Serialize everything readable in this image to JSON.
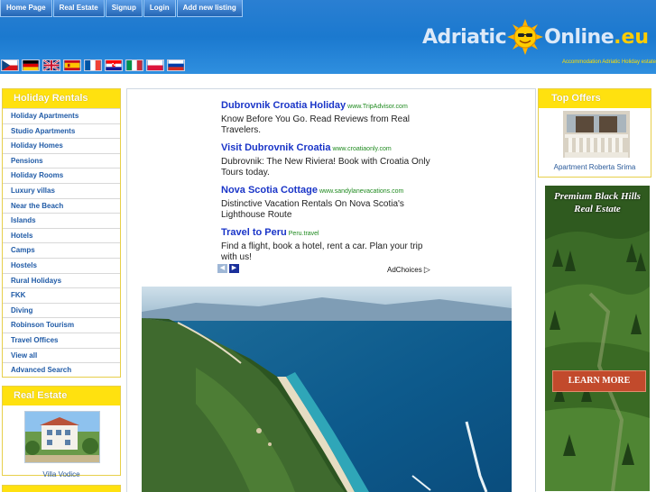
{
  "nav": {
    "items": [
      "Home Page",
      "Real Estate",
      "Signup",
      "Login",
      "Add new listing"
    ]
  },
  "logo": {
    "part1": "Adriatic",
    "part2": "Online",
    "tld": ".eu",
    "tagline": "Accommodation Adriatic Holiday estate",
    "icon": "sun-icon"
  },
  "flags": [
    "flag-czech",
    "flag-germany",
    "flag-uk",
    "flag-spain",
    "flag-france",
    "flag-croatia",
    "flag-italy",
    "flag-poland",
    "flag-russia"
  ],
  "holiday": {
    "title": "Holiday Rentals",
    "items": [
      "Holiday Apartments",
      "Studio Apartments",
      "Holiday Homes",
      "Pensions",
      "Holiday Rooms",
      "Luxury villas",
      "Near the Beach",
      "Islands",
      "Hotels",
      "Camps",
      "Hostels",
      "Rural Holidays",
      "FKK",
      "Diving",
      "Robinson Tourism",
      "Travel Offices",
      "View all",
      "Advanced Search"
    ]
  },
  "realestate": {
    "title": "Real Estate",
    "caption": "Villa Vodice"
  },
  "ads": [
    {
      "title": "Dubrovnik Croatia Holiday",
      "url": "www.TripAdvisor.com",
      "desc": "Know Before You Go. Read Reviews from Real Travelers."
    },
    {
      "title": "Visit Dubrovnik Croatia",
      "url": "www.croatiaonly.com",
      "desc": "Dubrovnik: The New Riviera! Book with Croatia Only Tours today."
    },
    {
      "title": "Nova Scotia Cottage",
      "url": "www.sandylanevacations.com",
      "desc": "Distinctive Vacation Rentals On Nova Scotia's Lighthouse Route"
    },
    {
      "title": "Travel to Peru",
      "url": "Peru.travel",
      "desc": "Find a flight, book a hotel, rent a car. Plan your trip with us!"
    }
  ],
  "adchoices": "AdChoices",
  "topoffers": {
    "title": "Top Offers",
    "caption": "Apartment Roberta Srima"
  },
  "banner": {
    "line1": "Premium Black Hills",
    "line2": "Real Estate",
    "cta": "LEARN MORE"
  },
  "colors": {
    "header": "#1b79cf",
    "panel_head": "#ffe10f",
    "link": "#1f5aa6",
    "ad_title": "#1a35c8",
    "ad_url": "#1f8a1f"
  }
}
